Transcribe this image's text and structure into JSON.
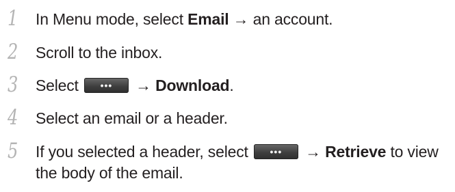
{
  "steps": [
    {
      "number": "1",
      "text_before": "In Menu mode, select ",
      "bold": "Email",
      "text_after": " → an account."
    },
    {
      "number": "2",
      "text": "Scroll to the inbox."
    },
    {
      "number": "3",
      "text_before": "Select ",
      "button_icon": "more-options-icon",
      "arrow": " → ",
      "bold": "Download",
      "text_after": "."
    },
    {
      "number": "4",
      "text": "Select an email or a header."
    },
    {
      "number": "5",
      "text_before": "If you selected a header, select ",
      "button_icon": "more-options-icon",
      "arrow": " → ",
      "bold": "Retrieve",
      "text_after": " to view the body of the email."
    }
  ],
  "button": {
    "dots": "•••"
  }
}
